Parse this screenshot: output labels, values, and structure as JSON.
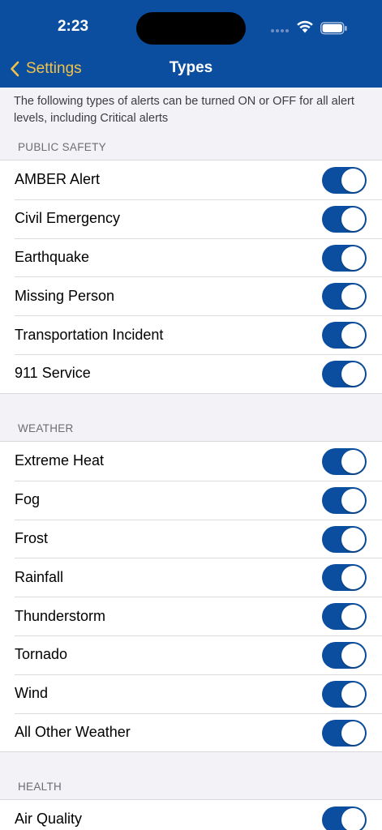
{
  "status_bar": {
    "time": "2:23"
  },
  "nav": {
    "back_label": "Settings",
    "title": "Types"
  },
  "intro": "The following types of alerts can be turned ON or OFF for all alert levels, including Critical alerts",
  "colors": {
    "header": "#0b4e9f",
    "back_accent": "#f0c24a",
    "toggle_on": "#0b4e9f"
  },
  "sections": [
    {
      "header": "PUBLIC SAFETY",
      "items": [
        {
          "label": "AMBER Alert",
          "on": true
        },
        {
          "label": "Civil Emergency",
          "on": true
        },
        {
          "label": "Earthquake",
          "on": true
        },
        {
          "label": "Missing Person",
          "on": true
        },
        {
          "label": "Transportation Incident",
          "on": true
        },
        {
          "label": "911 Service",
          "on": true
        }
      ]
    },
    {
      "header": "WEATHER",
      "items": [
        {
          "label": "Extreme Heat",
          "on": true
        },
        {
          "label": "Fog",
          "on": true
        },
        {
          "label": "Frost",
          "on": true
        },
        {
          "label": "Rainfall",
          "on": true
        },
        {
          "label": "Thunderstorm",
          "on": true
        },
        {
          "label": "Tornado",
          "on": true
        },
        {
          "label": "Wind",
          "on": true
        },
        {
          "label": "All Other Weather",
          "on": true
        }
      ]
    },
    {
      "header": "HEALTH",
      "items": [
        {
          "label": "Air Quality",
          "on": true
        }
      ]
    }
  ]
}
